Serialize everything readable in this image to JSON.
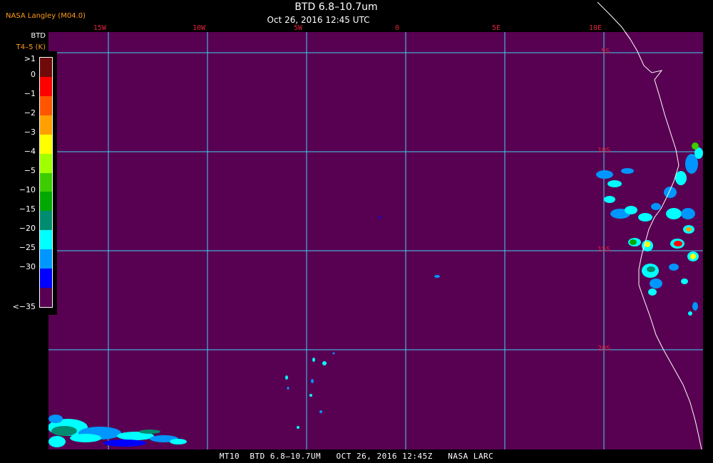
{
  "header": {
    "provider": "NASA Langley (M04.0)",
    "title": "BTD 6.8–10.7um",
    "subtitle": "Oct 26, 2016 12:45 UTC"
  },
  "legend": {
    "title": "BTD",
    "unit": "T4–5 (K)",
    "entries": [
      {
        "label": ">1",
        "color": "#6e0a0a"
      },
      {
        "label": "0",
        "color": "#ff0000"
      },
      {
        "label": "−1",
        "color": "#ff5500"
      },
      {
        "label": "−2",
        "color": "#ffa000"
      },
      {
        "label": "−3",
        "color": "#ffff00"
      },
      {
        "label": "−4",
        "color": "#a0ff00"
      },
      {
        "label": "−5",
        "color": "#3ccc00"
      },
      {
        "label": "−10",
        "color": "#00a800"
      },
      {
        "label": "−15",
        "color": "#008c6e"
      },
      {
        "label": "−20",
        "color": "#00ffff"
      },
      {
        "label": "−25",
        "color": "#0096ff"
      },
      {
        "label": "−30",
        "color": "#0000ff"
      },
      {
        "label": "<−35",
        "color": "#580052"
      }
    ]
  },
  "map": {
    "background_color": "#580052",
    "grid_color": "#3fd4f0",
    "coast_color": "#ffffff",
    "label_color": "#e0233a",
    "longitude_labels": [
      {
        "label": "15W",
        "lon": -15
      },
      {
        "label": "10W",
        "lon": -10
      },
      {
        "label": "5W",
        "lon": -5
      },
      {
        "label": "0",
        "lon": 0
      },
      {
        "label": "5E",
        "lon": 5
      },
      {
        "label": "10E",
        "lon": 10
      }
    ],
    "latitude_labels": [
      {
        "label": "5S",
        "lat": -5
      },
      {
        "label": "10S",
        "lat": -10
      },
      {
        "label": "15S",
        "lat": -15
      },
      {
        "label": "20S",
        "lat": -20
      }
    ]
  },
  "footer": {
    "caption": "MT10  BTD 6.8–10.7UM   OCT 26, 2016 12:45Z   NASA LARC"
  }
}
